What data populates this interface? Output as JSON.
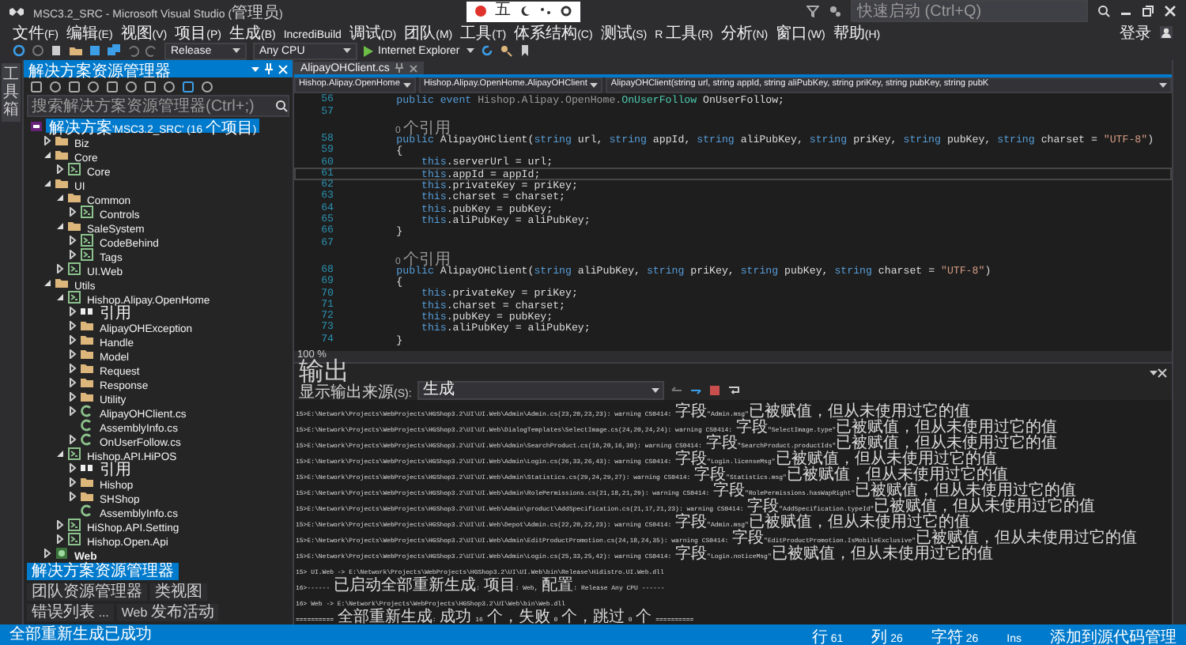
{
  "window": {
    "title": "MSC3.2_SRC - Microsoft Visual Studio (管理员)"
  },
  "ime_bar": {
    "mode": "五"
  },
  "quick_launch": {
    "placeholder": "快速启动 (Ctrl+Q)"
  },
  "menu": [
    "文件(F)",
    "编辑(E)",
    "视图(V)",
    "项目(P)",
    "生成(B)",
    "IncrediBuild",
    "调试(D)",
    "团队(M)",
    "工具(T)",
    "体系结构(C)",
    "测试(S)",
    "R 工具(R)",
    "分析(N)",
    "窗口(W)",
    "帮助(H)"
  ],
  "account": {
    "label": "登录"
  },
  "toolbar": {
    "configuration": "Release",
    "platform": "Any CPU",
    "run_target": "Internet Explorer"
  },
  "left_strip": {
    "tab": "工具箱"
  },
  "solution_explorer": {
    "title": "解决方案资源管理器",
    "search": {
      "placeholder": "搜索解决方案资源管理器(Ctrl+;)"
    },
    "tree": [
      {
        "label": "解决方案'MSC3.2_SRC' (16 个项目)",
        "kind": "solution",
        "selected": true,
        "children": [
          {
            "label": "Biz",
            "kind": "folder",
            "expanded": false,
            "selected": false
          },
          {
            "label": "Core",
            "kind": "folder",
            "expanded": true,
            "selected": false,
            "children": [
              {
                "label": "Core",
                "kind": "project",
                "expanded": false,
                "selected": false
              }
            ]
          },
          {
            "label": "UI",
            "kind": "folder",
            "expanded": true,
            "selected": false,
            "children": [
              {
                "label": "Common",
                "kind": "folder",
                "expanded": true,
                "selected": false,
                "children": [
                  {
                    "label": "Controls",
                    "kind": "project",
                    "expanded": false,
                    "selected": false
                  }
                ]
              },
              {
                "label": "SaleSystem",
                "kind": "folder",
                "expanded": true,
                "selected": false,
                "children": [
                  {
                    "label": "CodeBehind",
                    "kind": "project",
                    "expanded": false,
                    "selected": false
                  },
                  {
                    "label": "Tags",
                    "kind": "project",
                    "expanded": false,
                    "selected": false
                  }
                ]
              },
              {
                "label": "UI.Web",
                "kind": "project",
                "expanded": false,
                "selected": false
              }
            ]
          },
          {
            "label": "Utils",
            "kind": "folder",
            "expanded": true,
            "selected": false,
            "children": [
              {
                "label": "Hishop.Alipay.OpenHome",
                "kind": "project",
                "expanded": true,
                "selected": false,
                "children": [
                  {
                    "label": "引用",
                    "kind": "refs",
                    "expanded": false,
                    "selected": false
                  },
                  {
                    "label": "AlipayOHException",
                    "kind": "folder",
                    "expanded": false,
                    "selected": false
                  },
                  {
                    "label": "Handle",
                    "kind": "folder",
                    "expanded": false,
                    "selected": false
                  },
                  {
                    "label": "Model",
                    "kind": "folder",
                    "expanded": false,
                    "selected": false
                  },
                  {
                    "label": "Request",
                    "kind": "folder",
                    "expanded": false,
                    "selected": false
                  },
                  {
                    "label": "Response",
                    "kind": "folder",
                    "expanded": false,
                    "selected": false
                  },
                  {
                    "label": "Utility",
                    "kind": "folder",
                    "expanded": false,
                    "selected": false
                  },
                  {
                    "label": "AlipayOHClient.cs",
                    "kind": "cs",
                    "expanded": false,
                    "selected": false
                  },
                  {
                    "label": "AssemblyInfo.cs",
                    "kind": "cs",
                    "selected": false
                  },
                  {
                    "label": "OnUserFollow.cs",
                    "kind": "cs",
                    "expanded": false,
                    "selected": false
                  }
                ]
              },
              {
                "label": "Hishop.API.HiPOS",
                "kind": "project",
                "expanded": true,
                "selected": false,
                "children": [
                  {
                    "label": "引用",
                    "kind": "refs",
                    "expanded": false,
                    "selected": false
                  },
                  {
                    "label": "Hishop",
                    "kind": "folder",
                    "expanded": false,
                    "selected": false
                  },
                  {
                    "label": "SHShop",
                    "kind": "folder",
                    "expanded": false,
                    "selected": false
                  },
                  {
                    "label": "AssemblyInfo.cs",
                    "kind": "cs",
                    "selected": false
                  }
                ]
              },
              {
                "label": "HiShop.API.Setting",
                "kind": "project",
                "expanded": false,
                "selected": false
              },
              {
                "label": "Hishop.Open.Api",
                "kind": "project",
                "expanded": false,
                "selected": false
              }
            ]
          },
          {
            "label": "Web",
            "kind": "web",
            "expanded": false,
            "selected": false
          }
        ]
      }
    ]
  },
  "bottom_tabs": [
    {
      "label": "解决方案资源管理器",
      "selected": true
    },
    {
      "label": "团队资源管理器",
      "selected": false
    },
    {
      "label": "类视图",
      "selected": false
    }
  ],
  "tool_tabs": [
    {
      "label": "错误列表 ...",
      "selected": false
    },
    {
      "label": "Web 发布活动",
      "selected": false
    }
  ],
  "editor": {
    "tab": {
      "label": "AlipayOHClient.cs"
    },
    "nav": [
      "Hishop.Alipay.OpenHome",
      "Hishop.Alipay.OpenHome.AlipayOHClient",
      "AlipayOHClient(string url, string appId, string aliPubKey, string priKey, string pubKey, string pubK"
    ],
    "lines": [
      {
        "kind": "code",
        "number": "56",
        "current": false,
        "tokens": [
          {
            "kind": "kw",
            "text": "        public event"
          },
          {
            "kind": "dim",
            "text": " Hishop.Alipay.OpenHome."
          },
          {
            "kind": "type",
            "text": "OnUserFollow"
          },
          {
            "kind": "plain",
            "text": " OnUserFollow;"
          }
        ]
      },
      {
        "kind": "code",
        "number": "57",
        "current": false
      },
      {
        "kind": "lens",
        "text": "0 个引用"
      },
      {
        "kind": "code",
        "number": "58",
        "current": false,
        "tokens": [
          {
            "kind": "kw",
            "text": "        public"
          },
          {
            "kind": "plain",
            "text": " AlipayOHClient("
          },
          {
            "kind": "kw",
            "text": "string"
          },
          {
            "kind": "plain",
            "text": " url, "
          },
          {
            "kind": "kw",
            "text": "string"
          },
          {
            "kind": "plain",
            "text": " appId, "
          },
          {
            "kind": "kw",
            "text": "string"
          },
          {
            "kind": "plain",
            "text": " aliPubKey, "
          },
          {
            "kind": "kw",
            "text": "string"
          },
          {
            "kind": "plain",
            "text": " priKey, "
          },
          {
            "kind": "kw",
            "text": "string"
          },
          {
            "kind": "plain",
            "text": " pubKey, "
          },
          {
            "kind": "kw",
            "text": "string"
          },
          {
            "kind": "plain",
            "text": " charset = "
          },
          {
            "kind": "str",
            "text": "\"UTF-8\""
          },
          {
            "kind": "plain",
            "text": ")"
          }
        ]
      },
      {
        "kind": "code",
        "number": "59",
        "current": false,
        "tokens": [
          {
            "kind": "plain",
            "text": "        {"
          }
        ]
      },
      {
        "kind": "code",
        "number": "60",
        "current": false,
        "tokens": [
          {
            "kind": "kw",
            "text": "            this"
          },
          {
            "kind": "plain",
            "text": ".serverUrl = url;"
          }
        ]
      },
      {
        "kind": "code",
        "number": "61",
        "current": true,
        "tokens": [
          {
            "kind": "kw",
            "text": "            this"
          },
          {
            "kind": "plain",
            "text": ".appId = appId;"
          }
        ]
      },
      {
        "kind": "code",
        "number": "62",
        "current": false,
        "tokens": [
          {
            "kind": "kw",
            "text": "            this"
          },
          {
            "kind": "plain",
            "text": ".privateKey = priKey;"
          }
        ]
      },
      {
        "kind": "code",
        "number": "63",
        "current": false,
        "tokens": [
          {
            "kind": "kw",
            "text": "            this"
          },
          {
            "kind": "plain",
            "text": ".charset = charset;"
          }
        ]
      },
      {
        "kind": "code",
        "number": "64",
        "current": false,
        "tokens": [
          {
            "kind": "kw",
            "text": "            this"
          },
          {
            "kind": "plain",
            "text": ".pubKey = pubKey;"
          }
        ]
      },
      {
        "kind": "code",
        "number": "65",
        "current": false,
        "tokens": [
          {
            "kind": "kw",
            "text": "            this"
          },
          {
            "kind": "plain",
            "text": ".aliPubKey = aliPubKey;"
          }
        ]
      },
      {
        "kind": "code",
        "number": "66",
        "current": false,
        "tokens": [
          {
            "kind": "plain",
            "text": "        }"
          }
        ]
      },
      {
        "kind": "code",
        "number": "67",
        "current": false
      },
      {
        "kind": "lens",
        "text": "0 个引用"
      },
      {
        "kind": "code",
        "number": "68",
        "current": false,
        "tokens": [
          {
            "kind": "kw",
            "text": "        public"
          },
          {
            "kind": "plain",
            "text": " AlipayOHClient("
          },
          {
            "kind": "kw",
            "text": "string"
          },
          {
            "kind": "plain",
            "text": " aliPubKey, "
          },
          {
            "kind": "kw",
            "text": "string"
          },
          {
            "kind": "plain",
            "text": " priKey, "
          },
          {
            "kind": "kw",
            "text": "string"
          },
          {
            "kind": "plain",
            "text": " pubKey, "
          },
          {
            "kind": "kw",
            "text": "string"
          },
          {
            "kind": "plain",
            "text": " charset = "
          },
          {
            "kind": "str",
            "text": "\"UTF-8\""
          },
          {
            "kind": "plain",
            "text": ")"
          }
        ]
      },
      {
        "kind": "code",
        "number": "69",
        "current": false,
        "tokens": [
          {
            "kind": "plain",
            "text": "        {"
          }
        ]
      },
      {
        "kind": "code",
        "number": "70",
        "current": false,
        "tokens": [
          {
            "kind": "kw",
            "text": "            this"
          },
          {
            "kind": "plain",
            "text": ".privateKey = priKey;"
          }
        ]
      },
      {
        "kind": "code",
        "number": "71",
        "current": false,
        "tokens": [
          {
            "kind": "kw",
            "text": "            this"
          },
          {
            "kind": "plain",
            "text": ".charset = charset;"
          }
        ]
      },
      {
        "kind": "code",
        "number": "72",
        "current": false,
        "tokens": [
          {
            "kind": "kw",
            "text": "            this"
          },
          {
            "kind": "plain",
            "text": ".pubKey = pubKey;"
          }
        ]
      },
      {
        "kind": "code",
        "number": "73",
        "current": false,
        "tokens": [
          {
            "kind": "kw",
            "text": "            this"
          },
          {
            "kind": "plain",
            "text": ".aliPubKey = aliPubKey;"
          }
        ]
      },
      {
        "kind": "code",
        "number": "74",
        "current": false,
        "tokens": [
          {
            "kind": "plain",
            "text": "        }"
          }
        ]
      }
    ],
    "zoom": "100 %"
  },
  "output": {
    "title": "输出",
    "source_label": "显示输出来源(S):",
    "source": "生成",
    "lines": [
      "15>E:\\Network\\Projects\\WebProjects\\HGShop3.2\\UI\\UI.Web\\Admin\\Admin.cs(23,20,23,23): warning CS0414: 字段\"Admin.msg\"已被赋值，但从未使用过它的值",
      "15>E:\\Network\\Projects\\WebProjects\\HGShop3.2\\UI\\UI.Web\\DialogTemplates\\SelectImage.cs(24,20,24,24): warning CS0414: 字段\"SelectImage.type\"已被赋值，但从未使用过它的值",
      "15>E:\\Network\\Projects\\WebProjects\\HGShop3.2\\UI\\UI.Web\\Admin\\SearchProduct.cs(16,20,16,30): warning CS0414: 字段\"SearchProduct.productIds\"已被赋值，但从未使用过它的值",
      "15>E:\\Network\\Projects\\WebProjects\\HGShop3.2\\UI\\UI.Web\\Admin\\Login.cs(26,33,26,43): warning CS0414: 字段\"Login.licenseMsg\"已被赋值，但从未使用过它的值",
      "15>E:\\Network\\Projects\\WebProjects\\HGShop3.2\\UI\\UI.Web\\Admin\\Statistics.cs(29,24,29,27): warning CS0414: 字段\"Statistics.msg\"已被赋值，但从未使用过它的值",
      "15>E:\\Network\\Projects\\WebProjects\\HGShop3.2\\UI\\UI.Web\\Admin\\RolePermissions.cs(21,18,21,29): warning CS0414: 字段\"RolePermissions.hasWapRight\"已被赋值，但从未使用过它的值",
      "15>E:\\Network\\Projects\\WebProjects\\HGShop3.2\\UI\\UI.Web\\Admin\\product\\AddSpecification.cs(21,17,21,23): warning CS0414: 字段\"AddSpecification.typeId\"已被赋值，但从未使用过它的值",
      "15>E:\\Network\\Projects\\WebProjects\\HGShop3.2\\UI\\UI.Web\\Depot\\Admin.cs(22,20,22,23): warning CS0414: 字段\"Admin.msg\"已被赋值，但从未使用过它的值",
      "15>E:\\Network\\Projects\\WebProjects\\HGShop3.2\\UI\\UI.Web\\Admin\\EditProductPromotion.cs(24,18,24,35): warning CS0414: 字段\"EditProductPromotion.IsMobileExclusive\"已被赋值，但从未使用过它的值",
      "15>E:\\Network\\Projects\\WebProjects\\HGShop3.2\\UI\\UI.Web\\Admin\\Login.cs(25,33,25,42): warning CS0414: 字段\"Login.noticeMsg\"已被赋值，但从未使用过它的值",
      "15>  UI.Web -> E:\\Network\\Projects\\WebProjects\\HGShop3.2\\UI\\UI.Web\\bin\\Release\\Hidistro.UI.Web.dll",
      "16>------ 已启动全部重新生成: 项目: Web, 配置: Release Any CPU ------",
      "16>  Web -> E:\\Network\\Projects\\WebProjects\\HGShop3.2\\UI\\Web\\bin\\Web.dll",
      "========== 全部重新生成: 成功 16 个，失败 0 个，跳过 0 个 =========="
    ]
  },
  "status_bar": {
    "message": "全部重新生成已成功",
    "line": "行 61",
    "column": "列 26",
    "char": "字符 26",
    "mode": "Ins",
    "source_control": "添加到源代码管理"
  }
}
